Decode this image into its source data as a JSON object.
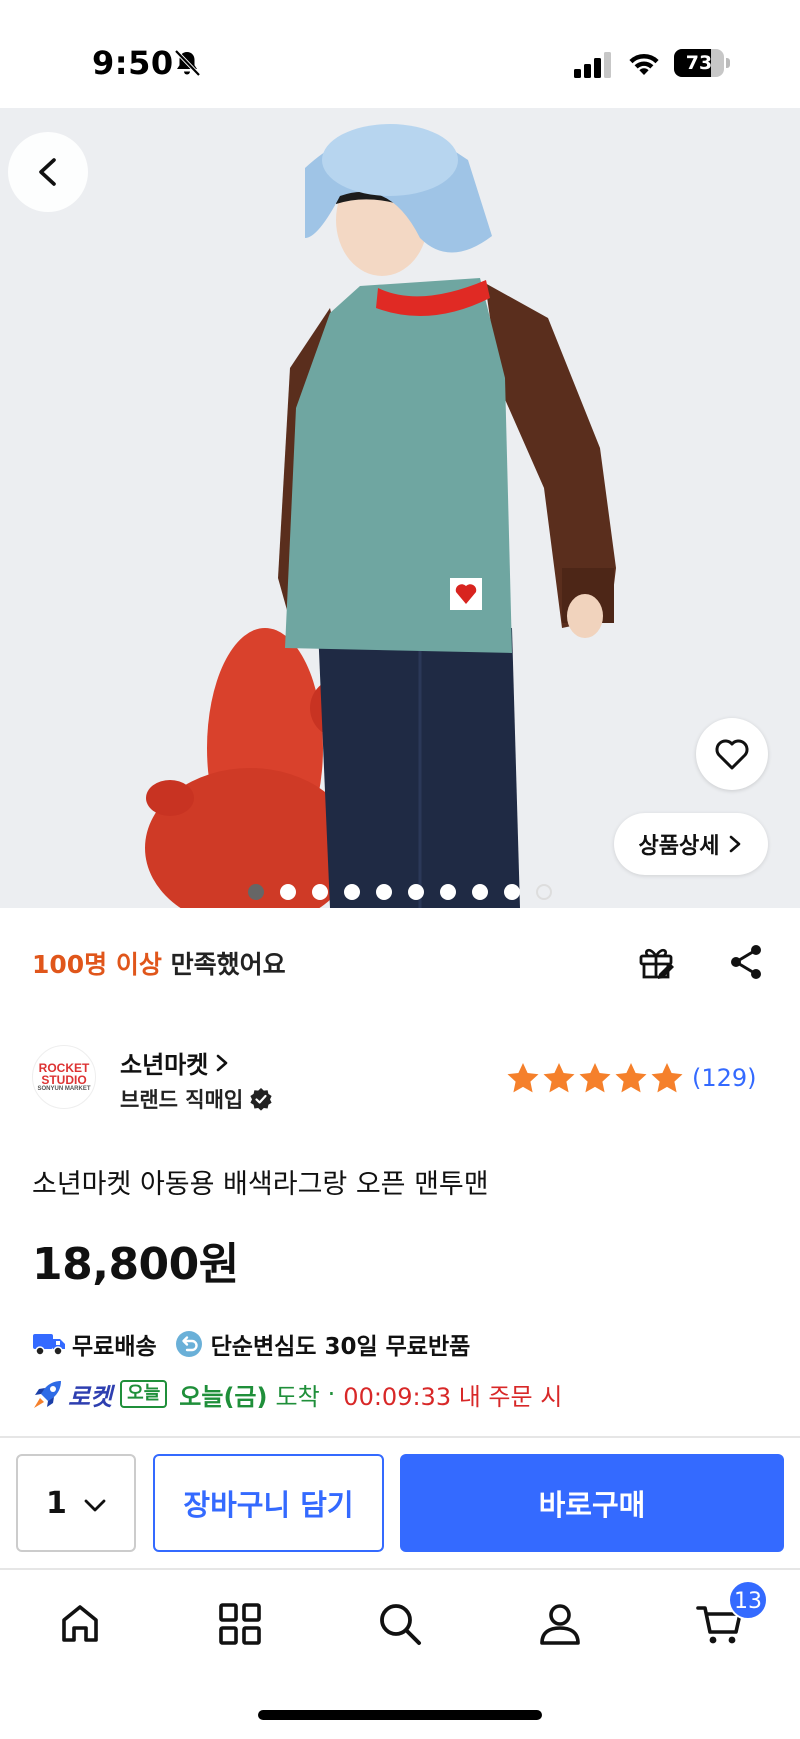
{
  "status_bar": {
    "time": "9:50",
    "battery": "73",
    "battery_level": 0.73
  },
  "hero": {
    "detail_label": "상품상세",
    "image_count": 10,
    "active_index": 0
  },
  "summary": {
    "satisfaction_highlight": "100명 이상",
    "satisfaction_rest": " 만족했어요"
  },
  "brand": {
    "logo_lines": [
      "ROCKET",
      "STUDIO",
      "SONYUN MARKET"
    ],
    "name": "소년마켓",
    "sub_label": "브랜드 직매입",
    "rating_stars": 5,
    "review_count": "(129)"
  },
  "product": {
    "title": "소년마켓 아동용 배색라그랑 오픈 맨투맨",
    "price": "18,800원"
  },
  "shipping": {
    "free_shipping": "무료배송",
    "free_return": "단순변심도 30일 무료반품",
    "rocket_label": "로켓",
    "today_badge": "오늘",
    "arrival_day": "오늘(금)",
    "arrival_text": "도착",
    "separator": "·",
    "deadline": "00:09:33 내 주문 시"
  },
  "actions": {
    "quantity": "1",
    "add_to_cart": "장바구니 담기",
    "buy_now": "바로구매"
  },
  "tab_bar": {
    "cart_badge": "13"
  },
  "colors": {
    "accent_blue": "#346aff",
    "highlight_orange": "#e0561b",
    "star_orange": "#f5802b",
    "rocket_green": "#1f8f3a",
    "deadline_red": "#d82828"
  }
}
